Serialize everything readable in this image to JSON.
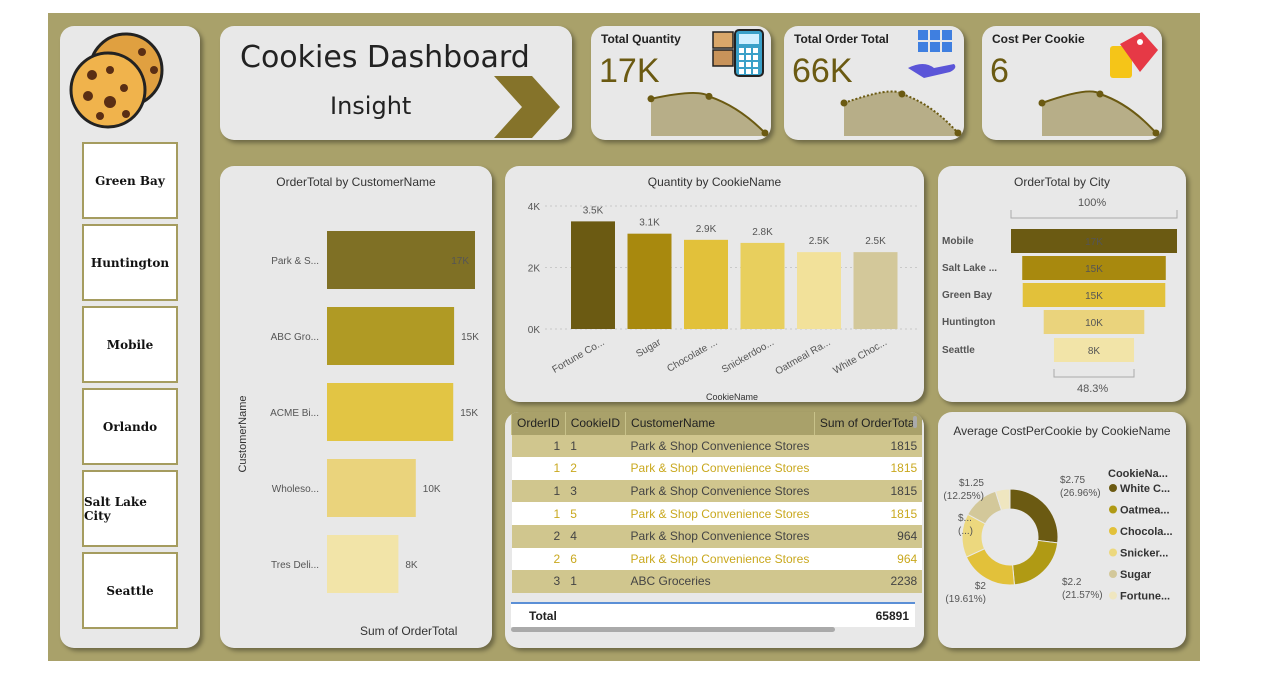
{
  "header": {
    "title": "Cookies Dashboard",
    "subtitle": "Insight"
  },
  "colors": {
    "frame": "#a9a16a",
    "panel": "#e8e8e8",
    "dark": "#6b5a12",
    "accent": "#e2c544",
    "area": "#b7ae88"
  },
  "slicer": {
    "items": [
      "Green Bay",
      "Huntington",
      "Mobile",
      "Orlando",
      "Salt Lake City",
      "Seattle"
    ]
  },
  "kpis": [
    {
      "title": "Total Quantity",
      "value": "17K",
      "icon": "calculator-icon",
      "trend": [
        0.62,
        0.66,
        0.05
      ]
    },
    {
      "title": "Total Order Total",
      "value": "66K",
      "icon": "hand-boxes-icon",
      "trend": [
        0.55,
        0.7,
        0.05
      ]
    },
    {
      "title": "Cost Per Cookie",
      "value": "6",
      "icon": "price-tag-icon",
      "trend": [
        0.55,
        0.7,
        0.05
      ]
    }
  ],
  "customer_chart": {
    "title": "OrderTotal by CustomerName",
    "ylabel": "CustomerName",
    "xlabel": "Sum of OrderTotal"
  },
  "quantity_chart": {
    "title": "Quantity by CookieName",
    "xlabel": "CookieName"
  },
  "city_chart": {
    "title": "OrderTotal by City",
    "top_pct": "100%",
    "bottom_pct": "48.3%"
  },
  "donut_chart": {
    "title": "Average CostPerCookie by CookieName",
    "legend_title": "CookieNa...",
    "legend": [
      "White C...",
      "Oatmea...",
      "Chocola...",
      "Snicker...",
      "Sugar",
      "Fortune..."
    ],
    "labels": [
      {
        "value": "$2.75",
        "pct": "(26.96%)"
      },
      {
        "value": "$2.2",
        "pct": "(21.57%)"
      },
      {
        "value": "$2",
        "pct": "(19.61%)"
      },
      {
        "value": "$...",
        "pct": "(...)"
      },
      {
        "value": "$1.25",
        "pct": "(12.25%)"
      }
    ]
  },
  "table": {
    "columns": [
      "OrderID",
      "CookieID",
      "CustomerName",
      "Sum of OrderTotal"
    ],
    "rows": [
      [
        "1",
        "1",
        "Park & Shop Convenience Stores",
        "1815"
      ],
      [
        "1",
        "2",
        "Park & Shop Convenience Stores",
        "1815"
      ],
      [
        "1",
        "3",
        "Park & Shop Convenience Stores",
        "1815"
      ],
      [
        "1",
        "5",
        "Park & Shop Convenience Stores",
        "1815"
      ],
      [
        "2",
        "4",
        "Park & Shop Convenience Stores",
        "964"
      ],
      [
        "2",
        "6",
        "Park & Shop Convenience Stores",
        "964"
      ],
      [
        "3",
        "1",
        "ABC Groceries",
        "2238"
      ]
    ],
    "total_label": "Total",
    "total_value": "65891"
  },
  "chart_data": [
    {
      "type": "bar",
      "title": "OrderTotal by CustomerName",
      "orientation": "horizontal",
      "xlabel": "Sum of OrderTotal",
      "ylabel": "CustomerName",
      "categories": [
        "Park & S...",
        "ABC Gro...",
        "ACME Bi...",
        "Wholeso...",
        "Tres Deli..."
      ],
      "values": [
        17000,
        14600,
        14500,
        10200,
        8200
      ],
      "data_labels": [
        "17K",
        "15K",
        "15K",
        "10K",
        "8K"
      ],
      "colors": [
        "#7f7025",
        "#b09a24",
        "#e2c544",
        "#ead37c",
        "#f2e4a8"
      ]
    },
    {
      "type": "bar",
      "title": "Quantity by CookieName",
      "xlabel": "CookieName",
      "categories": [
        "Fortune Co...",
        "Sugar",
        "Chocolate ...",
        "Snickerdoo...",
        "Oatmeal Ra...",
        "White Choc..."
      ],
      "values": [
        3500,
        3100,
        2900,
        2800,
        2500,
        2500
      ],
      "data_labels": [
        "3.5K",
        "3.1K",
        "2.9K",
        "2.8K",
        "2.5K",
        "2.5K"
      ],
      "yticks": [
        "0K",
        "2K",
        "4K"
      ],
      "ylim": [
        0,
        4000
      ],
      "grid": true,
      "colors": [
        "#6b5a12",
        "#a8890e",
        "#e2c13a",
        "#e8cf5d",
        "#f2e19a",
        "#d3c89a"
      ]
    },
    {
      "type": "bar",
      "title": "OrderTotal by City",
      "subtype": "funnel",
      "categories": [
        "Mobile",
        "Salt Lake ...",
        "Green Bay",
        "Huntington",
        "Seattle"
      ],
      "values": [
        17000,
        14700,
        14600,
        10300,
        8200
      ],
      "data_labels": [
        "17K",
        "15K",
        "15K",
        "10K",
        "8K"
      ],
      "colors": [
        "#6b5a12",
        "#a8890e",
        "#e2c13a",
        "#ead37c",
        "#f2e4a8"
      ]
    },
    {
      "type": "pie",
      "subtype": "donut",
      "title": "Average CostPerCookie by CookieName",
      "categories": [
        "White Chocolate",
        "Oatmeal",
        "Chocolate",
        "Snickerdoodle",
        "Sugar",
        "Fortune"
      ],
      "values": [
        2.75,
        2.2,
        2,
        1.5,
        1.25,
        0.5
      ],
      "colors": [
        "#6b5a12",
        "#b09a14",
        "#e2c13a",
        "#ecd87e",
        "#d3c89a",
        "#efe6c0"
      ]
    }
  ]
}
